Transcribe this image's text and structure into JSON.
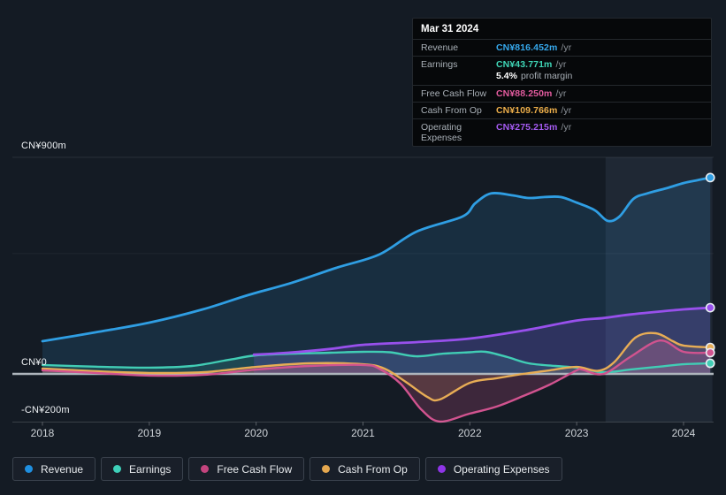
{
  "tooltip": {
    "date": "Mar 31 2024",
    "rows": [
      {
        "key": "revenue",
        "label": "Revenue",
        "value": "CN¥816.452m",
        "suffix": "/yr",
        "color": "#36a8ec"
      },
      {
        "key": "earnings",
        "label": "Earnings",
        "value": "CN¥43.771m",
        "suffix": "/yr",
        "color": "#3fd6b7",
        "margin_bold": "5.4%",
        "margin_text": "profit margin"
      },
      {
        "key": "free-cash-flow",
        "label": "Free Cash Flow",
        "value": "CN¥88.250m",
        "suffix": "/yr",
        "color": "#e25b9e"
      },
      {
        "key": "cash-from-op",
        "label": "Cash From Op",
        "value": "CN¥109.766m",
        "suffix": "/yr",
        "color": "#ecae4a"
      },
      {
        "key": "operating-expenses",
        "label": "Operating Expenses",
        "value": "CN¥275.215m",
        "suffix": "/yr",
        "color": "#a55bf2"
      }
    ]
  },
  "legend": {
    "items": [
      {
        "key": "revenue",
        "label": "Revenue",
        "color": "#1f8fe0"
      },
      {
        "key": "earnings",
        "label": "Earnings",
        "color": "#3ed0b9"
      },
      {
        "key": "free-cash-flow",
        "label": "Free Cash Flow",
        "color": "#c4447e"
      },
      {
        "key": "cash-from-op",
        "label": "Cash From Op",
        "color": "#e5a84f"
      },
      {
        "key": "operating-expenses",
        "label": "Operating Expenses",
        "color": "#8f35e8"
      }
    ]
  },
  "y_axis": {
    "tick_labels": [
      {
        "text": "CN¥900m",
        "value": 900
      },
      {
        "text": "CN¥0",
        "value": 0
      },
      {
        "text": "-CN¥200m",
        "value": -200
      }
    ]
  },
  "x_axis": {
    "tick_labels": [
      "2018",
      "2019",
      "2020",
      "2021",
      "2022",
      "2023",
      "2024"
    ]
  },
  "chart_data": {
    "type": "area",
    "title": "",
    "xlabel": "",
    "ylabel": "CN¥ millions",
    "x_unit": "year",
    "xlim": [
      2018,
      2024.3
    ],
    "ylim": [
      -200,
      900
    ],
    "grid_values_minor": [
      900,
      500
    ],
    "zero_line_value": 0,
    "axis_line_value": -200,
    "legend_position": "bottom",
    "highlight_span": [
      2023.27,
      2024.27
    ],
    "series": [
      {
        "name": "Revenue",
        "key": "revenue",
        "color": "#2f9ee3",
        "fill": "rgba(47,158,227,0.15)",
        "line_width": 2.8,
        "points": [
          [
            2018,
            136
          ],
          [
            2018.5,
            173
          ],
          [
            2019,
            213
          ],
          [
            2019.5,
            268
          ],
          [
            2019.92,
            327
          ],
          [
            2020.33,
            378
          ],
          [
            2020.75,
            441
          ],
          [
            2021.15,
            496
          ],
          [
            2021.5,
            591
          ],
          [
            2021.93,
            654
          ],
          [
            2022.05,
            709
          ],
          [
            2022.2,
            750
          ],
          [
            2022.4,
            742
          ],
          [
            2022.55,
            731
          ],
          [
            2022.7,
            735
          ],
          [
            2022.85,
            735
          ],
          [
            2023,
            712
          ],
          [
            2023.17,
            680
          ],
          [
            2023.29,
            636
          ],
          [
            2023.4,
            654
          ],
          [
            2023.53,
            727
          ],
          [
            2023.66,
            750
          ],
          [
            2023.85,
            773
          ],
          [
            2024,
            793
          ],
          [
            2024.13,
            805
          ],
          [
            2024.25,
            816
          ]
        ]
      },
      {
        "name": "Earnings",
        "key": "earnings",
        "color": "#41cdb5",
        "fill": "rgba(65,205,181,0.16)",
        "line_width": 2.4,
        "points": [
          [
            2018,
            37
          ],
          [
            2018.5,
            30
          ],
          [
            2019,
            26
          ],
          [
            2019.4,
            33
          ],
          [
            2019.75,
            59
          ],
          [
            2020,
            77
          ],
          [
            2020.35,
            84
          ],
          [
            2020.7,
            88
          ],
          [
            2021,
            92
          ],
          [
            2021.25,
            90
          ],
          [
            2021.5,
            73
          ],
          [
            2021.75,
            84
          ],
          [
            2022,
            90
          ],
          [
            2022.15,
            92
          ],
          [
            2022.35,
            70
          ],
          [
            2022.55,
            44
          ],
          [
            2022.8,
            33
          ],
          [
            2023,
            26
          ],
          [
            2023.25,
            7
          ],
          [
            2023.5,
            18
          ],
          [
            2023.75,
            29
          ],
          [
            2024,
            40
          ],
          [
            2024.25,
            44
          ]
        ]
      },
      {
        "name": "Cash From Op",
        "key": "cash-from-op",
        "color": "#e8ad55",
        "fill": "rgba(232,173,85,0.16)",
        "line_width": 2.4,
        "points": [
          [
            2018,
            22
          ],
          [
            2018.5,
            11
          ],
          [
            2019,
            4
          ],
          [
            2019.5,
            7
          ],
          [
            2020,
            29
          ],
          [
            2020.5,
            44
          ],
          [
            2021,
            40
          ],
          [
            2021.2,
            22
          ],
          [
            2021.4,
            -33
          ],
          [
            2021.6,
            -95
          ],
          [
            2021.72,
            -106
          ],
          [
            2022,
            -37
          ],
          [
            2022.25,
            -18
          ],
          [
            2022.5,
            0
          ],
          [
            2022.75,
            15
          ],
          [
            2023,
            29
          ],
          [
            2023.2,
            13
          ],
          [
            2023.35,
            48
          ],
          [
            2023.55,
            151
          ],
          [
            2023.74,
            169
          ],
          [
            2023.9,
            136
          ],
          [
            2024,
            118
          ],
          [
            2024.25,
            110
          ]
        ]
      },
      {
        "name": "Free Cash Flow",
        "key": "free-cash-flow",
        "color": "#d1538f",
        "fill": "rgba(209,83,143,0.22)",
        "line_width": 2.4,
        "points": [
          [
            2018,
            15
          ],
          [
            2018.5,
            4
          ],
          [
            2019,
            -7
          ],
          [
            2019.5,
            -4
          ],
          [
            2020,
            18
          ],
          [
            2020.5,
            33
          ],
          [
            2021,
            37
          ],
          [
            2021.15,
            22
          ],
          [
            2021.35,
            -40
          ],
          [
            2021.55,
            -150
          ],
          [
            2021.72,
            -198
          ],
          [
            2022,
            -165
          ],
          [
            2022.25,
            -136
          ],
          [
            2022.5,
            -92
          ],
          [
            2022.75,
            -44
          ],
          [
            2023,
            15
          ],
          [
            2023.05,
            18
          ],
          [
            2023.25,
            0
          ],
          [
            2023.5,
            70
          ],
          [
            2023.78,
            139
          ],
          [
            2024,
            92
          ],
          [
            2024.25,
            88
          ]
        ]
      },
      {
        "name": "Operating Expenses",
        "key": "operating-expenses",
        "color": "#9850ec",
        "fill": "rgba(152,80,236,0.18)",
        "line_width": 2.8,
        "points": [
          [
            2019.98,
            80
          ],
          [
            2020.3,
            88
          ],
          [
            2020.7,
            104
          ],
          [
            2021,
            121
          ],
          [
            2021.5,
            132
          ],
          [
            2022,
            147
          ],
          [
            2022.5,
            180
          ],
          [
            2023,
            222
          ],
          [
            2023.25,
            232
          ],
          [
            2023.5,
            247
          ],
          [
            2024,
            268
          ],
          [
            2024.25,
            275
          ]
        ]
      }
    ]
  }
}
